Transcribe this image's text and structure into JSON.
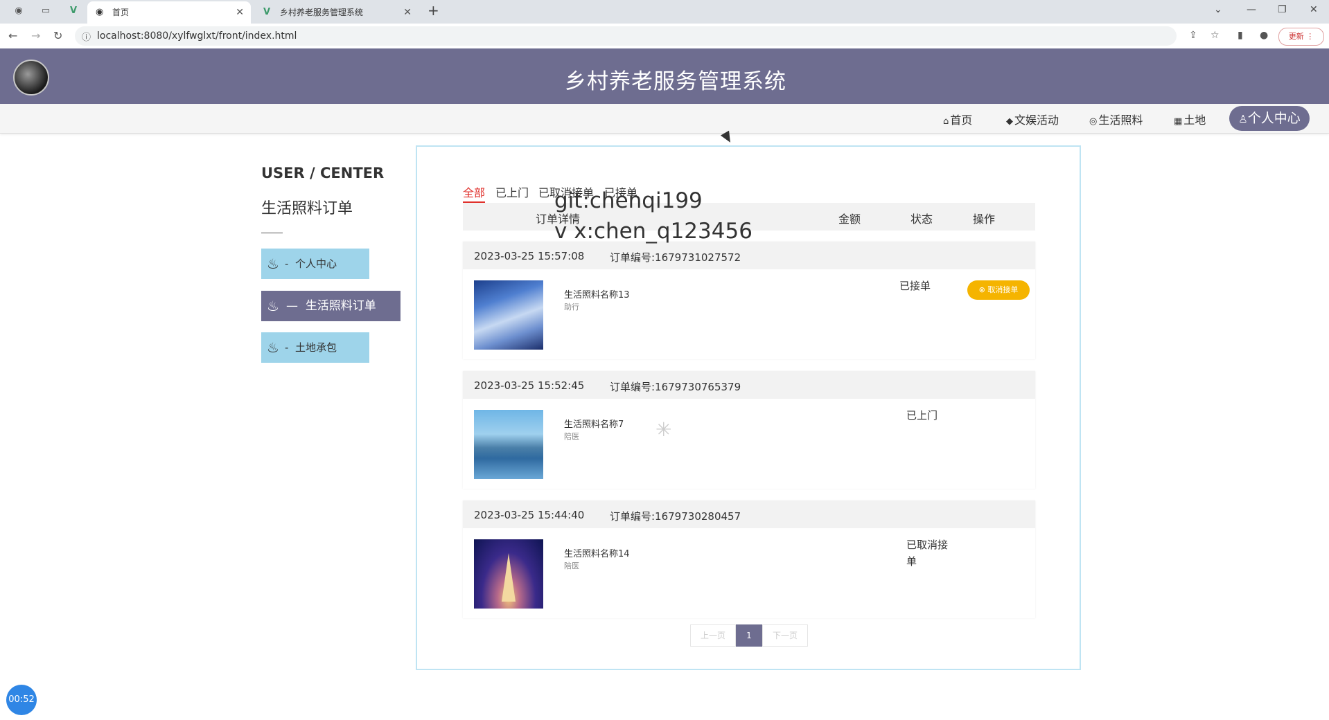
{
  "browser": {
    "tabs": [
      {
        "label": "首页",
        "active": true
      },
      {
        "label": "乡村养老服务管理系统",
        "active": false
      }
    ],
    "url": "localhost:8080/xylfwglxt/front/index.html",
    "update_label": "更新"
  },
  "header": {
    "title": "乡村养老服务管理系统"
  },
  "nav": {
    "items": [
      {
        "icon": "home-icon",
        "label": "首页"
      },
      {
        "icon": "graduation-cap-icon",
        "label": "文娱活动"
      },
      {
        "icon": "palette-icon",
        "label": "生活照料"
      },
      {
        "icon": "grid-icon",
        "label": "土地"
      }
    ],
    "active": {
      "icon": "user-icon",
      "label": "个人中心"
    }
  },
  "sidebar": {
    "title": "USER / CENTER",
    "subtitle": "生活照料订单",
    "items": [
      {
        "prefix": "-",
        "label": "个人中心"
      },
      {
        "prefix": "—",
        "label": "生活照料订单",
        "active": true
      },
      {
        "prefix": "-",
        "label": "土地承包"
      }
    ]
  },
  "filters": [
    "全部",
    "已上门",
    "已取消接单",
    "已接单"
  ],
  "table_headers": [
    "订单详情",
    "金额",
    "状态",
    "操作"
  ],
  "orders": [
    {
      "time": "2023-03-25 15:57:08",
      "order_no": "订单编号:1679731027572",
      "name": "生活照料名称13",
      "category": "助行",
      "status": "已接单",
      "action": "取消接单",
      "image": "sky-clouds"
    },
    {
      "time": "2023-03-25 15:52:45",
      "order_no": "订单编号:1679730765379",
      "name": "生活照料名称7",
      "category": "陪医",
      "status": "已上门",
      "image": "lake"
    },
    {
      "time": "2023-03-25 15:44:40",
      "order_no": "订单编号:1679730280457",
      "name": "生活照料名称14",
      "category": "陪医",
      "status": "已取消接单",
      "image": "eiffel-tower"
    }
  ],
  "pagination": {
    "prev": "上一页",
    "current": "1",
    "next": "下一页"
  },
  "watermark": {
    "line1": "git:chenqi199",
    "line2": "v x:chen_q123456"
  },
  "timer": "00:52"
}
